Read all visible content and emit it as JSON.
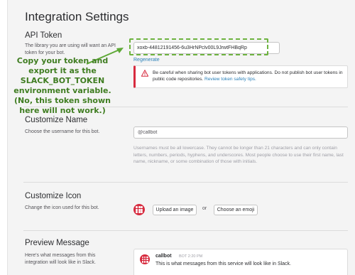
{
  "page": {
    "title": "Integration Settings"
  },
  "api_token": {
    "title": "API Token",
    "description": "The library you are using will want an API token for your bot.",
    "token_value": "xoxb-44812191456-6u3HrNPclv00L9JrwtFHBqRp",
    "regenerate_label": "Regenerate",
    "warning_text": "Be careful when sharing bot user tokens with applications. Do not publish bot user tokens in public code repositories.",
    "warning_link": "Review token safety tips."
  },
  "annotation": {
    "lines": [
      "Copy your token and",
      "export it as the",
      "SLACK_BOT_TOKEN",
      "environment variable.",
      "(No, this token shown",
      "here will not work.)"
    ],
    "color": "#3f7d21"
  },
  "customize_name": {
    "title": "Customize Name",
    "description": "Choose the username for this bot.",
    "username_value": "@callbot",
    "help_text": "Usernames must be all lowercase. They cannot be longer than 21 characters and can only contain letters, numbers, periods, hyphens, and underscores. Most people choose to use their first name, last name, nickname, or some combination of those with initials."
  },
  "customize_icon": {
    "title": "Customize Icon",
    "description": "Change the icon used for this bot.",
    "upload_label": "Upload an image",
    "or_label": "or",
    "emoji_label": "Choose an emoji",
    "icon": "bot-dots-icon"
  },
  "preview_message": {
    "title": "Preview Message",
    "description": "Here's what messages from this integration will look like in Slack.",
    "bot_name": "callbot",
    "bot_tag": "BOT",
    "time": "2:20 PM",
    "message": "This is what messages from this service will look like in Slack."
  },
  "colors": {
    "accent_red": "#d72b3f",
    "link_blue": "#2a80b9",
    "highlight_green": "#6db33f"
  }
}
